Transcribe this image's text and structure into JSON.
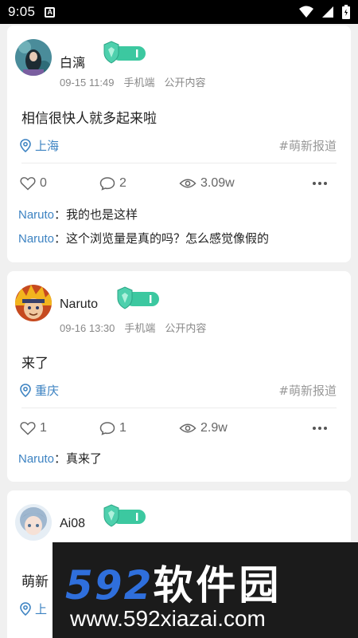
{
  "status_bar": {
    "time": "9:05",
    "notification_icon": "A"
  },
  "posts": [
    {
      "author": "白漓",
      "date": "09-15 11:49",
      "device": "手机端",
      "visibility": "公开内容",
      "content": "相信很快人就多起来啦",
      "location": "上海",
      "tag": "#萌新报道",
      "likes": "0",
      "comments": "2",
      "views": "3.09w",
      "replies": [
        {
          "user": "Naruto",
          "sep": "：",
          "text": "我的也是这样"
        },
        {
          "user": "Naruto",
          "sep": "：",
          "text": "这个浏览量是真的吗？怎么感觉像假的"
        }
      ]
    },
    {
      "author": "Naruto",
      "date": "09-16 13:30",
      "device": "手机端",
      "visibility": "公开内容",
      "content": "来了",
      "location": "重庆",
      "tag": "#萌新报道",
      "likes": "1",
      "comments": "1",
      "views": "2.9w",
      "replies": [
        {
          "user": "Naruto",
          "sep": "：",
          "text": "真来了"
        }
      ]
    },
    {
      "author": "Ai08",
      "content": "萌新",
      "location": "上"
    }
  ],
  "watermark": {
    "brand_number": "592",
    "brand_cn": "软件园",
    "url": "www.592xiazai.com"
  },
  "colors": {
    "accent_blue": "#3d83c2",
    "badge_green": "#3cc8a0",
    "meta_gray": "#888888"
  }
}
